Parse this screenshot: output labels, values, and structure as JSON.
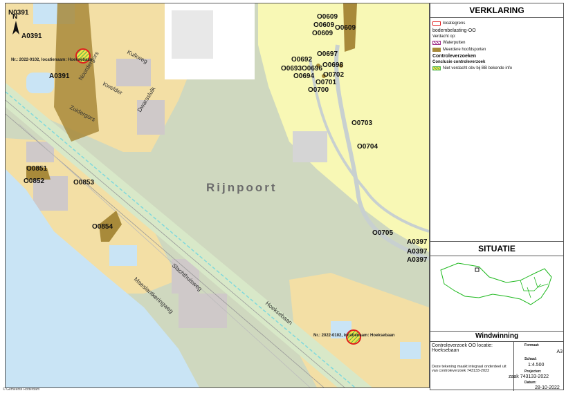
{
  "map": {
    "area_label": "Rijnpoort",
    "streets": [
      "Kulkweg",
      "Noordergors",
      "Kwelder",
      "Zuidergors",
      "Dwarsslulk",
      "Hoeksebaan",
      "Slachthuisweg",
      "Maeslantkeringweg",
      "Slachthuisweg"
    ],
    "location_notes": [
      "Nr.: 2022-0102, locatienaam: Hoeksebaan",
      "Nr.: 2022-0102, locatienaam: Hoeksebaan"
    ],
    "parcel_labels": [
      "N0391",
      "A0391",
      "A0391",
      "O0609",
      "O0609",
      "O0609",
      "O0609",
      "O0697",
      "O0692",
      "O0698",
      "O0693",
      "O0696",
      "O0702",
      "O0694",
      "O0701",
      "O0700",
      "O0703",
      "O0704",
      "O0705",
      "A0397",
      "A0397",
      "A0397",
      "O0851",
      "O0852",
      "O0853",
      "O0854"
    ],
    "north_arrow": "N",
    "copyright": "© Gemeente Rotterdam"
  },
  "legend": {
    "title": "VERKLARING",
    "items": [
      {
        "label": "locatiegrens",
        "icon": "red-outline-swatch"
      },
      {
        "label": "bodembelasting-OO",
        "icon": "none"
      },
      {
        "label": "Verdacht op:",
        "icon": "none"
      },
      {
        "label": "Waterputten",
        "icon": "purple-hatch-swatch"
      },
      {
        "label": "Meerdere hoofdsporten",
        "icon": "brown-fill-swatch"
      },
      {
        "label": "Controleverzoeken",
        "icon": "none"
      },
      {
        "label": "Conclusie controleverzoek",
        "icon": "none"
      },
      {
        "label": "Niet verdacht obv bij BB bekende info",
        "icon": "green-yellow-hatch-swatch"
      }
    ]
  },
  "situation": {
    "title": "SITUATIE"
  },
  "titleblock": {
    "org": "Windwinning",
    "description": "Controleverzoek OO locatie: Hoeksebaan",
    "note": "Deze tekening maakt integraal onderdeel uit van controleverzoek 743133-2022",
    "format_label": "Formaat:",
    "format": "A3",
    "scale_label": "Schaal:",
    "scale": "1:4.500",
    "project_label": "Projecten:",
    "project": "zaak 743133-2022",
    "date_label": "Datum:",
    "date": "28-10-2022"
  },
  "colors": {
    "field": "#cfd8bf",
    "industrial": "#f3dfa5",
    "yellow_zone": "#f8f8b5",
    "water": "#c9e4f5",
    "contamination": "#a88a3a",
    "red_outline": "#e01e1e"
  }
}
